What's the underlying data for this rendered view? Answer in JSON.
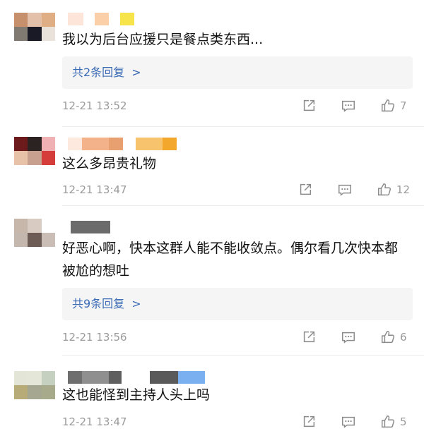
{
  "colors": {
    "link": "#3b6bb5",
    "muted": "#9a9a9a",
    "reply_bg": "#f5f5f5"
  },
  "icons": {
    "share": "share-icon",
    "comment": "comment-icon",
    "like": "thumbs-up-icon"
  },
  "comments": [
    {
      "text": "我以为后台应援只是餐点类东西...",
      "replies_label": "共2条回复",
      "time": "12-21 13:52",
      "likes": "7",
      "avatar_colors": [
        "#c7906d",
        "#e2c0aa",
        "#dfae84",
        "#817a72",
        "#191a26",
        "#e9e2da"
      ],
      "name_colors": [
        "#fde6d9",
        "#fff",
        "#fbd0a8",
        "#fff",
        "#f7e44b"
      ]
    },
    {
      "text": "这么多昂贵礼物",
      "time": "12-21 13:47",
      "likes": "12",
      "avatar_colors": [
        "#6c1a1c",
        "#2a2322",
        "#f0b1b5",
        "#e7c2a8",
        "#c7a090",
        "#d43d3a"
      ],
      "name_colors": [
        "#fde9dd",
        "#f4b28b",
        "#e8a070",
        "#fff",
        "#f7c36d",
        "#f3a82d"
      ]
    },
    {
      "text": "好恶心啊，快本这群人能不能收敛点。偶尔看几次快本都被尬的想吐",
      "replies_label": "共9条回复",
      "time": "12-21 13:56",
      "likes": "6",
      "avatar_colors": [
        "#c7b6aa",
        "#d8cbc2",
        "#ffffff",
        "#c4b7ae",
        "#6c5c55",
        "#c9bdb5"
      ],
      "name_colors": [
        "#fff",
        "#6b6b6b"
      ]
    },
    {
      "text": "这也能怪到主持人头上吗",
      "time": "12-21 13:47",
      "likes": "5",
      "avatar_colors": [
        "#e3e6d6",
        "#e4e6d8",
        "#c6d0c0",
        "#b7ac77",
        "#a6a790",
        "#a8aa8c"
      ],
      "name_colors": [
        "#6e6e6e",
        "#8f8f8f",
        "#5f5f5f",
        "#fff",
        "#5a5a5a",
        "#7ab0f0"
      ]
    }
  ]
}
